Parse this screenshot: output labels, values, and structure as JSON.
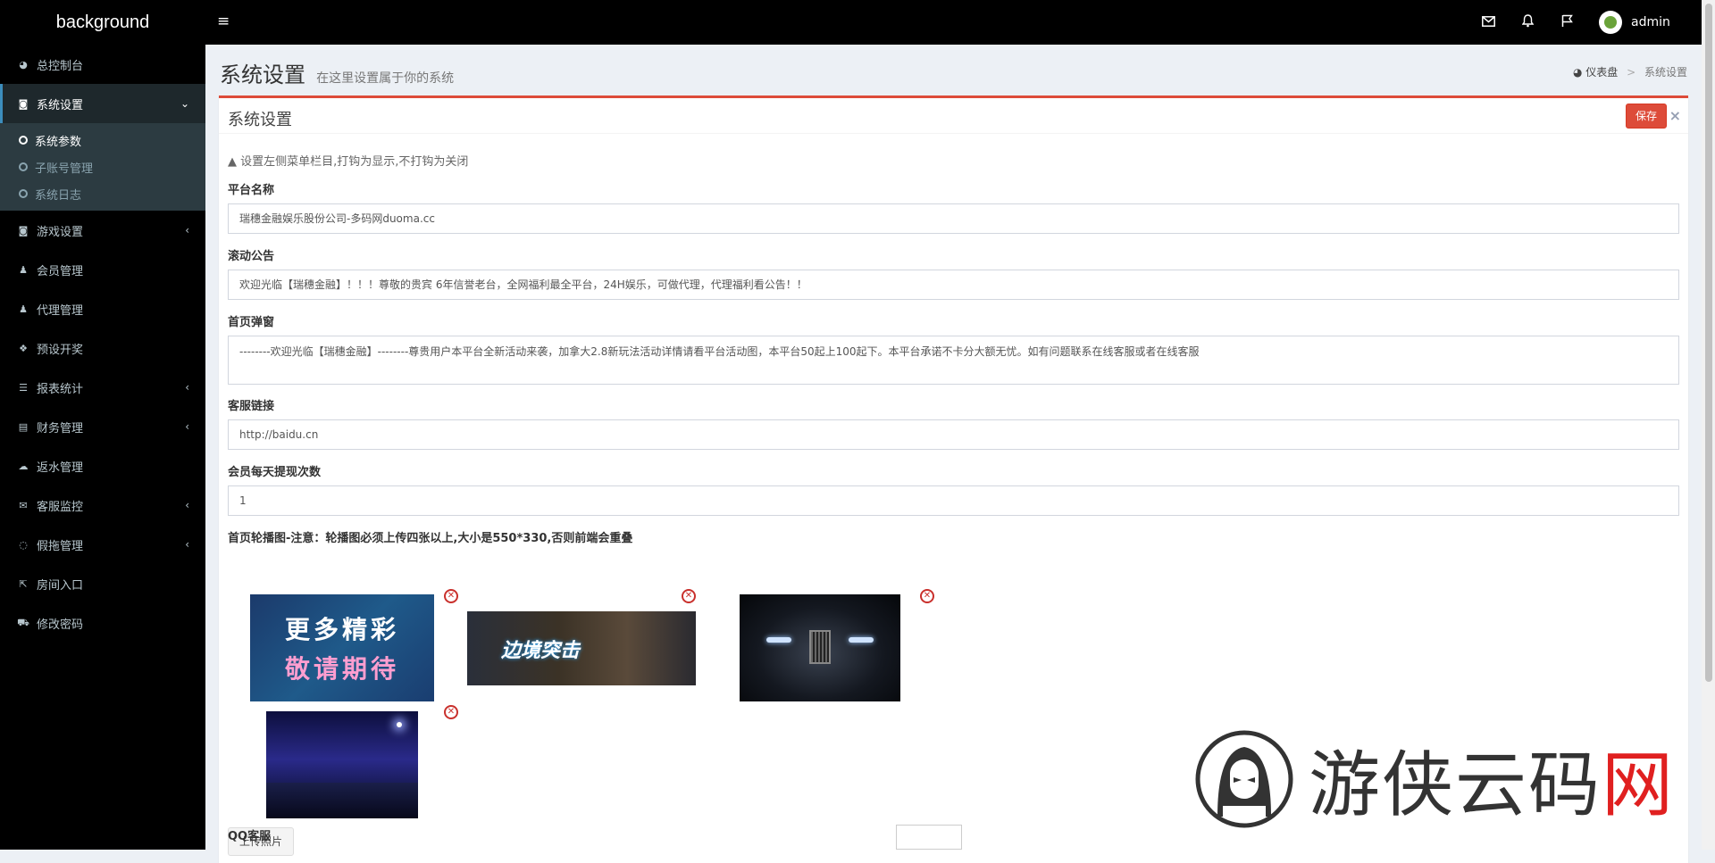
{
  "brand": "background",
  "user": {
    "name": "admin"
  },
  "sidebar": {
    "items": [
      {
        "label": "总控制台",
        "icon": "dashboard-icon"
      },
      {
        "label": "系统设置",
        "icon": "gamepad-icon"
      },
      {
        "label": "游戏设置",
        "icon": "gamepad-icon"
      },
      {
        "label": "会员管理",
        "icon": "users-icon"
      },
      {
        "label": "代理管理",
        "icon": "users-icon"
      },
      {
        "label": "预设开奖",
        "icon": "cubes-icon"
      },
      {
        "label": "报表统计",
        "icon": "list-icon"
      },
      {
        "label": "财务管理",
        "icon": "database-icon"
      },
      {
        "label": "返水管理",
        "icon": "cloud-icon"
      },
      {
        "label": "客服监控",
        "icon": "comments-icon"
      },
      {
        "label": "假拖管理",
        "icon": "comment-icon"
      },
      {
        "label": "房间入口",
        "icon": "external-link-icon"
      },
      {
        "label": "修改密码",
        "icon": "cart-icon"
      }
    ],
    "sub": [
      {
        "label": "系统参数"
      },
      {
        "label": "子账号管理"
      },
      {
        "label": "系统日志"
      }
    ]
  },
  "header": {
    "title": "系统设置",
    "subtitle": "在这里设置属于你的系统"
  },
  "breadcrumb": {
    "home": "仪表盘",
    "current": "系统设置"
  },
  "box": {
    "title": "系统设置",
    "save": "保存",
    "close": "×",
    "note": "设置左侧菜单栏目,打钩为显示,不打钩为关闭"
  },
  "form": {
    "platform_name": {
      "label": "平台名称",
      "value": "瑞穗金融娱乐股份公司-多码网duoma.cc"
    },
    "marquee": {
      "label": "滚动公告",
      "value": "欢迎光临【瑞穗金融】！！！尊敬的贵宾 6年信誉老台，全网福利最全平台，24H娱乐，可做代理，代理福利看公告！！"
    },
    "popup": {
      "label": "首页弹窗",
      "value": "--------欢迎光临【瑞穗金融】--------尊贵用户本平台全新活动来袭，加拿大2.8新玩法活动详情请看平台活动图，本平台50起上100起下。本平台承诺不卡分大额无忧。如有问题联系在线客服或者在线客服"
    },
    "service_link": {
      "label": "客服链接",
      "value": "http://baidu.cn"
    },
    "withdraw_times": {
      "label": "会员每天提现次数",
      "value": "1"
    },
    "carousel": {
      "label": "首页轮播图-注意：轮播图必须上传四张以上,大小是550*330,否则前端会重叠"
    },
    "upload": "上传照片",
    "qq": {
      "label": "QQ客服"
    }
  },
  "banner1": {
    "line1": "更多精彩",
    "line2": "敬请期待"
  },
  "banner2": {
    "text": "边境突击"
  },
  "watermark": {
    "text": "游侠云码",
    "accent": "网"
  },
  "colors": {
    "sidebar": "#000000",
    "accent": "#dd4b39",
    "active_border": "#3c8dbc",
    "content_bg": "#ecf0f5"
  }
}
